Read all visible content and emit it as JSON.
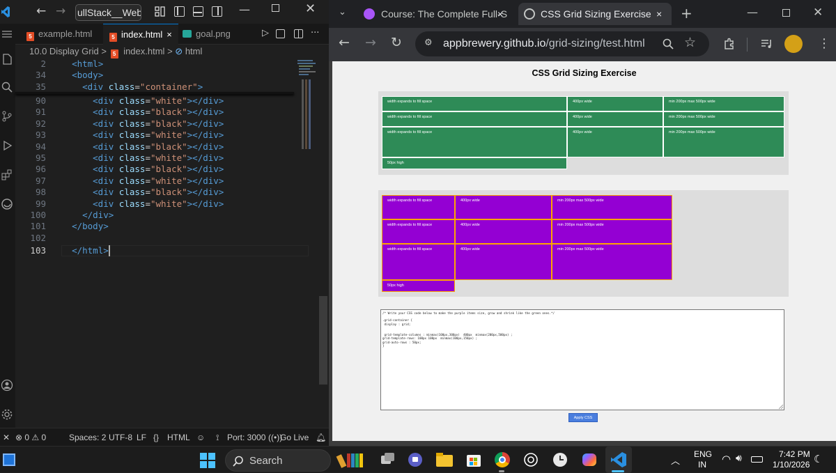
{
  "vscode": {
    "title_search": "ullStack__WebD",
    "tabs": [
      {
        "label": "example.html",
        "icon": "html5-icon"
      },
      {
        "label": "index.html",
        "icon": "html5-icon",
        "active": true,
        "close": "×"
      },
      {
        "label": "goal.png",
        "icon": "image-icon"
      }
    ],
    "breadcrumb": {
      "folder": "10.0 Display Grid",
      "sep": ">",
      "file": "index.html",
      "symbol": "html"
    },
    "lines": [
      {
        "n": "2",
        "parts": [
          [
            "punc",
            "  "
          ],
          [
            "tag",
            "<html>"
          ]
        ]
      },
      {
        "n": "34",
        "parts": [
          [
            "punc",
            "  "
          ],
          [
            "tag",
            "<body>"
          ]
        ]
      },
      {
        "n": "35",
        "parts": [
          [
            "punc",
            "    "
          ],
          [
            "tag",
            "<div "
          ],
          [
            "attr",
            "class"
          ],
          [
            "txt",
            "="
          ],
          [
            "str",
            "\"container\""
          ],
          [
            "tag",
            ">"
          ]
        ]
      },
      {
        "n": "90",
        "parts": [
          [
            "punc",
            "      "
          ],
          [
            "tag",
            "<div "
          ],
          [
            "attr",
            "class"
          ],
          [
            "txt",
            "="
          ],
          [
            "str",
            "\"white\""
          ],
          [
            "tag",
            "></div>"
          ]
        ]
      },
      {
        "n": "91",
        "parts": [
          [
            "punc",
            "      "
          ],
          [
            "tag",
            "<div "
          ],
          [
            "attr",
            "class"
          ],
          [
            "txt",
            "="
          ],
          [
            "str",
            "\"black\""
          ],
          [
            "tag",
            "></div>"
          ]
        ]
      },
      {
        "n": "92",
        "parts": [
          [
            "punc",
            "      "
          ],
          [
            "tag",
            "<div "
          ],
          [
            "attr",
            "class"
          ],
          [
            "txt",
            "="
          ],
          [
            "str",
            "\"black\""
          ],
          [
            "tag",
            "></div>"
          ]
        ]
      },
      {
        "n": "93",
        "parts": [
          [
            "punc",
            "      "
          ],
          [
            "tag",
            "<div "
          ],
          [
            "attr",
            "class"
          ],
          [
            "txt",
            "="
          ],
          [
            "str",
            "\"white\""
          ],
          [
            "tag",
            "></div>"
          ]
        ]
      },
      {
        "n": "94",
        "parts": [
          [
            "punc",
            "      "
          ],
          [
            "tag",
            "<div "
          ],
          [
            "attr",
            "class"
          ],
          [
            "txt",
            "="
          ],
          [
            "str",
            "\"black\""
          ],
          [
            "tag",
            "></div>"
          ]
        ]
      },
      {
        "n": "95",
        "parts": [
          [
            "punc",
            "      "
          ],
          [
            "tag",
            "<div "
          ],
          [
            "attr",
            "class"
          ],
          [
            "txt",
            "="
          ],
          [
            "str",
            "\"white\""
          ],
          [
            "tag",
            "></div>"
          ]
        ]
      },
      {
        "n": "96",
        "parts": [
          [
            "punc",
            "      "
          ],
          [
            "tag",
            "<div "
          ],
          [
            "attr",
            "class"
          ],
          [
            "txt",
            "="
          ],
          [
            "str",
            "\"black\""
          ],
          [
            "tag",
            "></div>"
          ]
        ]
      },
      {
        "n": "97",
        "parts": [
          [
            "punc",
            "      "
          ],
          [
            "tag",
            "<div "
          ],
          [
            "attr",
            "class"
          ],
          [
            "txt",
            "="
          ],
          [
            "str",
            "\"white\""
          ],
          [
            "tag",
            "></div>"
          ]
        ]
      },
      {
        "n": "98",
        "parts": [
          [
            "punc",
            "      "
          ],
          [
            "tag",
            "<div "
          ],
          [
            "attr",
            "class"
          ],
          [
            "txt",
            "="
          ],
          [
            "str",
            "\"black\""
          ],
          [
            "tag",
            "></div>"
          ]
        ]
      },
      {
        "n": "99",
        "parts": [
          [
            "punc",
            "      "
          ],
          [
            "tag",
            "<div "
          ],
          [
            "attr",
            "class"
          ],
          [
            "txt",
            "="
          ],
          [
            "str",
            "\"white\""
          ],
          [
            "tag",
            "></div>"
          ]
        ]
      },
      {
        "n": "100",
        "parts": [
          [
            "punc",
            "    "
          ],
          [
            "tag",
            "</div>"
          ]
        ]
      },
      {
        "n": "101",
        "parts": [
          [
            "punc",
            "  "
          ],
          [
            "tag",
            "</body>"
          ]
        ]
      },
      {
        "n": "102",
        "parts": []
      },
      {
        "n": "103",
        "parts": [
          [
            "punc",
            "  "
          ],
          [
            "tag",
            "</html>"
          ]
        ],
        "current": true
      }
    ],
    "status": {
      "errors": "0",
      "warnings": "0",
      "spaces": "Spaces: 2",
      "encoding": "UTF-8",
      "eol": "LF",
      "lang_braces": "{}",
      "language": "HTML",
      "port": "Port: 3000",
      "golive": "Go Live"
    }
  },
  "chrome": {
    "tabs": [
      {
        "label": "Course: The Complete Full-S",
        "close": "×"
      },
      {
        "label": "CSS Grid Sizing Exercise",
        "close": "×",
        "active": true
      }
    ],
    "new_tab": "+",
    "url_host": "appbrewery.github.io",
    "url_path": "/grid-sizing/test.html"
  },
  "page": {
    "title": "CSS Grid Sizing Exercise",
    "green_cells": [
      "width expands to fill space",
      "400px wide",
      "min 200px max 500px wide",
      "width expands to fill space",
      "400px wide",
      "min 200px max 500px wide",
      "width expands to fill space",
      "400px wide",
      "min 200px max 500px wide",
      "50px high"
    ],
    "purple_cells": [
      "width expands to fill space",
      "400px wide",
      "min 200px max 500px wide",
      "width expands to fill space",
      "400px wide",
      "min 200px max 500px wide",
      "width expands to fill space",
      "400px wide",
      "min 200px max 500px wide",
      "50px high"
    ],
    "css_text": "/* Write your CSS code below to make the purple items size, grow and shrink like the green ones.*/\n\n.grid-container {\n display : grid;\n\n\n grid-template-columns : minmax(100px,300px)  400px  minmax(200px,500px) ;\ngrid-template-rows: 100px 100px  minmax(100px,150px) ;\ngrid-auto-rows : 50px;\n}",
    "apply_label": "Apply CSS"
  },
  "taskbar": {
    "search_label": "Search",
    "lang": "ENG",
    "region": "IN",
    "time": "7:42 PM",
    "date": "1/10/2026"
  }
}
